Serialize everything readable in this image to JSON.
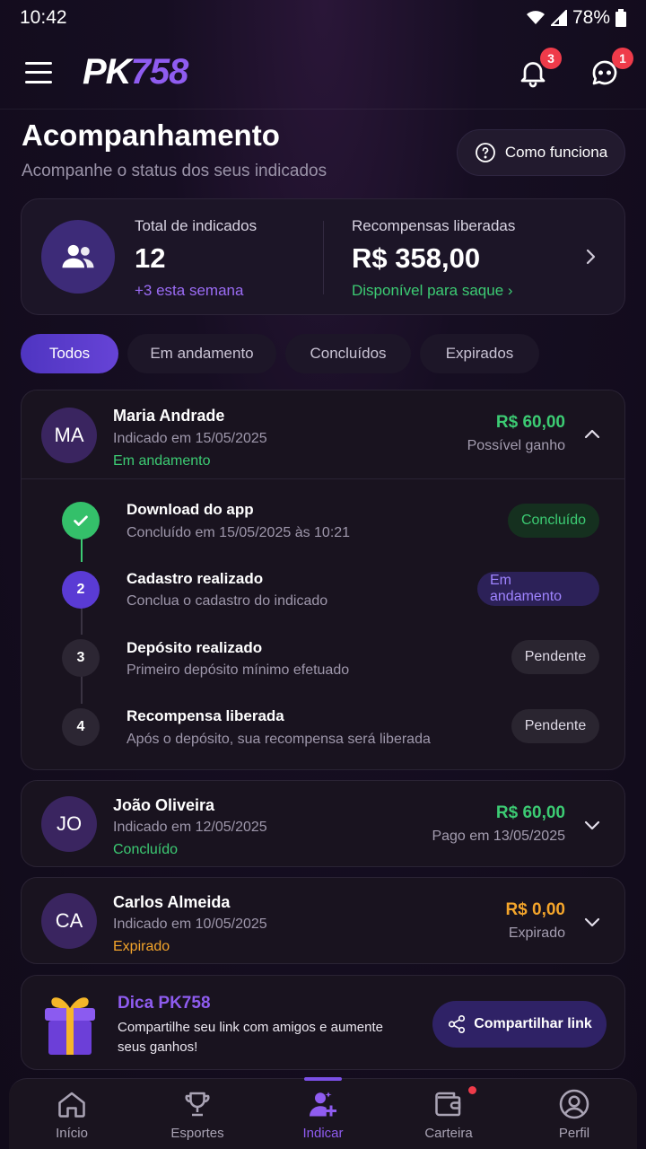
{
  "status_bar": {
    "time": "10:42",
    "battery": "78%"
  },
  "header": {
    "logo_pk": "PK",
    "logo_num": "758",
    "notifications_count": "3",
    "messages_count": "1"
  },
  "page": {
    "title": "Acompanhamento",
    "subtitle": "Acompanhe o status dos seus indicados",
    "how_button": "Como funciona"
  },
  "summary": {
    "total_label": "Total de indicados",
    "total_value": "12",
    "total_delta": "+3 esta semana",
    "rewards_label": "Recompensas liberadas",
    "rewards_value": "R$ 358,00",
    "rewards_status": "Disponível para saque ›"
  },
  "tabs": [
    {
      "label": "Todos"
    },
    {
      "label": "Em andamento"
    },
    {
      "label": "Concluídos"
    },
    {
      "label": "Expirados"
    }
  ],
  "referrals": [
    {
      "initials": "MA",
      "name": "Maria Andrade",
      "date": "Indicado em 15/05/2025",
      "status": "Em andamento",
      "amount": "R$ 60,00",
      "note": "Possível ganho",
      "steps": [
        {
          "num": "",
          "title": "Download do app",
          "desc": "Concluído em 15/05/2025 às 10:21",
          "chip": "Concluído"
        },
        {
          "num": "2",
          "title": "Cadastro realizado",
          "desc": "Conclua o cadastro do indicado",
          "chip": "Em andamento"
        },
        {
          "num": "3",
          "title": "Depósito realizado",
          "desc": "Primeiro depósito mínimo efetuado",
          "chip": "Pendente"
        },
        {
          "num": "4",
          "title": "Recompensa liberada",
          "desc": "Após o depósito, sua recompensa será liberada",
          "chip": "Pendente"
        }
      ]
    },
    {
      "initials": "JO",
      "name": "João Oliveira",
      "date": "Indicado em 12/05/2025",
      "status": "Concluído",
      "amount": "R$ 60,00",
      "note": "Pago em 13/05/2025"
    },
    {
      "initials": "CA",
      "name": "Carlos Almeida",
      "date": "Indicado em 10/05/2025",
      "status": "Expirado",
      "amount": "R$ 0,00",
      "note": "Expirado"
    }
  ],
  "tip": {
    "title": "Dica PK758",
    "text": "Compartilhe seu link com amigos e aumente seus ganhos!",
    "share_button": "Compartilhar link"
  },
  "bottom_nav": [
    {
      "label": "Início",
      "icon": "home-icon"
    },
    {
      "label": "Esportes",
      "icon": "trophy-icon"
    },
    {
      "label": "Indicar",
      "icon": "add-user-icon"
    },
    {
      "label": "Carteira",
      "icon": "wallet-icon"
    },
    {
      "label": "Perfil",
      "icon": "profile-icon"
    }
  ],
  "colors": {
    "accent": "#8f5cf0",
    "success": "#3ccb73",
    "warning": "#f4a52b",
    "badge": "#ef3b4a"
  }
}
